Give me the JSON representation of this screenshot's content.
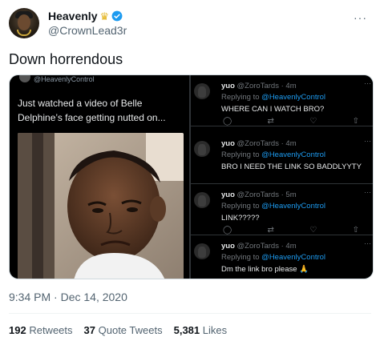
{
  "author": {
    "name": "Heavenly",
    "handle": "@CrownLead3r",
    "badge_icon": "crown-icon",
    "verified_icon": "verified-icon",
    "verified_color": "#1d9bf0"
  },
  "tweet": {
    "text": "Down horrendous",
    "timestamp": "9:34 PM · Dec 14, 2020"
  },
  "media": {
    "left": {
      "handle": "@HeavenlyControl",
      "caption": "Just watched a video of Belle Delphine’s face getting nutted on..."
    },
    "replies": [
      {
        "name": "yuo",
        "handle": "@ZoroTards",
        "time": "4m",
        "replying_prefix": "Replying to ",
        "replying_to": "@HeavenlyControl",
        "text": "WHERE CAN I WATCH BRO?",
        "show_actions": true
      },
      {
        "name": "yuo",
        "handle": "@ZoroTards",
        "time": "4m",
        "replying_prefix": "Replying to ",
        "replying_to": "@HeavenlyControl",
        "text": "BRO I NEED THE LINK SO BADDLYYTY",
        "show_actions": false
      },
      {
        "name": "yuo",
        "handle": "@ZoroTards",
        "time": "5m",
        "replying_prefix": "Replying to ",
        "replying_to": "@HeavenlyControl",
        "text": "LINK?????",
        "show_actions": true
      },
      {
        "name": "yuo",
        "handle": "@ZoroTards",
        "time": "4m",
        "replying_prefix": "Replying to ",
        "replying_to": "@HeavenlyControl",
        "text": "Dm the link bro please 🙏",
        "show_actions": false
      }
    ]
  },
  "stats": {
    "retweets_count": "192",
    "retweets_label": "Retweets",
    "quotes_count": "37",
    "quotes_label": "Quote Tweets",
    "likes_count": "5,381",
    "likes_label": "Likes"
  },
  "colors": {
    "accent": "#1d9bf0",
    "secondary_text": "#536471",
    "media_bg": "#000000"
  }
}
